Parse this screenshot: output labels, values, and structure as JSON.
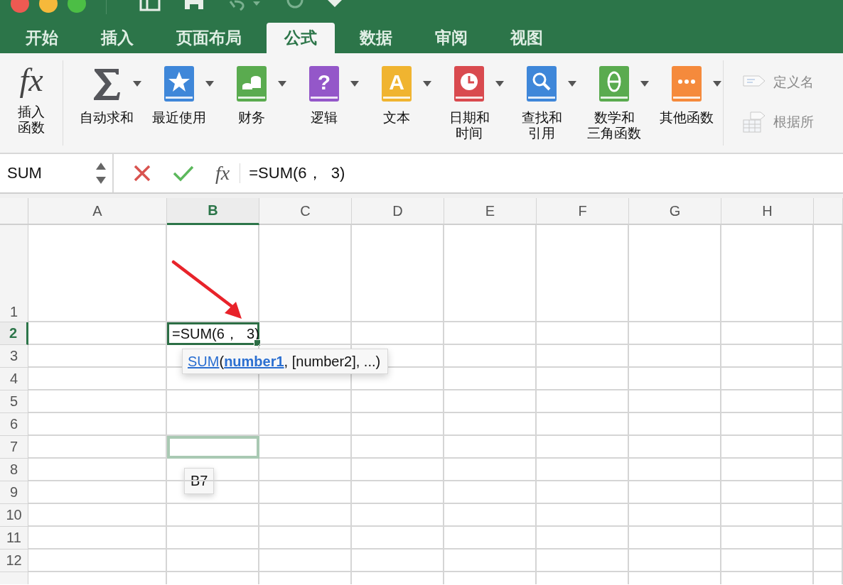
{
  "tabs": [
    {
      "label": "开始",
      "selected": false
    },
    {
      "label": "插入",
      "selected": false
    },
    {
      "label": "页面布局",
      "selected": false
    },
    {
      "label": "公式",
      "selected": true
    },
    {
      "label": "数据",
      "selected": false
    },
    {
      "label": "审阅",
      "selected": false
    },
    {
      "label": "视图",
      "selected": false
    }
  ],
  "ribbon": {
    "insert_function": {
      "glyph": "fx",
      "label": [
        "插入",
        "函数"
      ]
    },
    "groups": [
      {
        "label": "自动求和",
        "kind": "sigma",
        "menu": true
      },
      {
        "label": "最近使用",
        "kind": "star",
        "color": "#3f87d9",
        "menu": true
      },
      {
        "label": "财务",
        "kind": "coins",
        "color": "#5aab4f",
        "menu": true
      },
      {
        "label": "逻辑",
        "kind": "question",
        "color": "#9457c9",
        "glyph": "?",
        "menu": true
      },
      {
        "label": "文本",
        "kind": "letter",
        "color": "#f0b430",
        "glyph": "A",
        "menu": true
      },
      {
        "label": [
          "日期和",
          "时间"
        ],
        "kind": "clock",
        "color": "#d94a4f",
        "menu": true
      },
      {
        "label": [
          "查找和",
          "引用"
        ],
        "kind": "search",
        "color": "#3f87d9",
        "menu": true
      },
      {
        "label": [
          "数学和",
          "三角函数"
        ],
        "kind": "theta",
        "color": "#5aab4f",
        "menu": true
      },
      {
        "label": "其他函数",
        "kind": "dots",
        "color": "#f58a3c",
        "menu": true
      }
    ],
    "names": [
      {
        "label": "定义名",
        "kind": "tag",
        "disabled": true
      },
      {
        "label": "根据所",
        "kind": "table",
        "disabled": true
      }
    ]
  },
  "name_box": {
    "value": "SUM"
  },
  "formula_bar": {
    "glyph": "fx",
    "value": "=SUM(6，  3)"
  },
  "sheet": {
    "columns": [
      {
        "label": "A",
        "selected": false
      },
      {
        "label": "B",
        "selected": true
      },
      {
        "label": "C",
        "selected": false
      },
      {
        "label": "D",
        "selected": false
      },
      {
        "label": "E",
        "selected": false
      },
      {
        "label": "F",
        "selected": false
      },
      {
        "label": "G",
        "selected": false
      },
      {
        "label": "H",
        "selected": false
      }
    ],
    "rows": [
      {
        "label": "1",
        "selected": false
      },
      {
        "label": "2",
        "selected": true,
        "cells": [
          {
            "kind": "editing",
            "value": "=SUM(6，  3)"
          }
        ]
      },
      {
        "label": "3",
        "selected": false
      },
      {
        "label": "4",
        "selected": false
      },
      {
        "label": "5",
        "selected": false
      },
      {
        "label": "6",
        "selected": false
      },
      {
        "label": "7",
        "selected": false,
        "cells": [
          {
            "kind": "reference",
            "tag": "B7"
          }
        ]
      },
      {
        "label": "8",
        "selected": false
      },
      {
        "label": "9",
        "selected": false
      },
      {
        "label": "10",
        "selected": false
      },
      {
        "label": "11",
        "selected": false
      },
      {
        "label": "12",
        "selected": false
      }
    ],
    "tooltip": {
      "function": "SUM",
      "open": "(",
      "current_argument": "number1",
      "rest": ", [number2], ...)"
    }
  }
}
